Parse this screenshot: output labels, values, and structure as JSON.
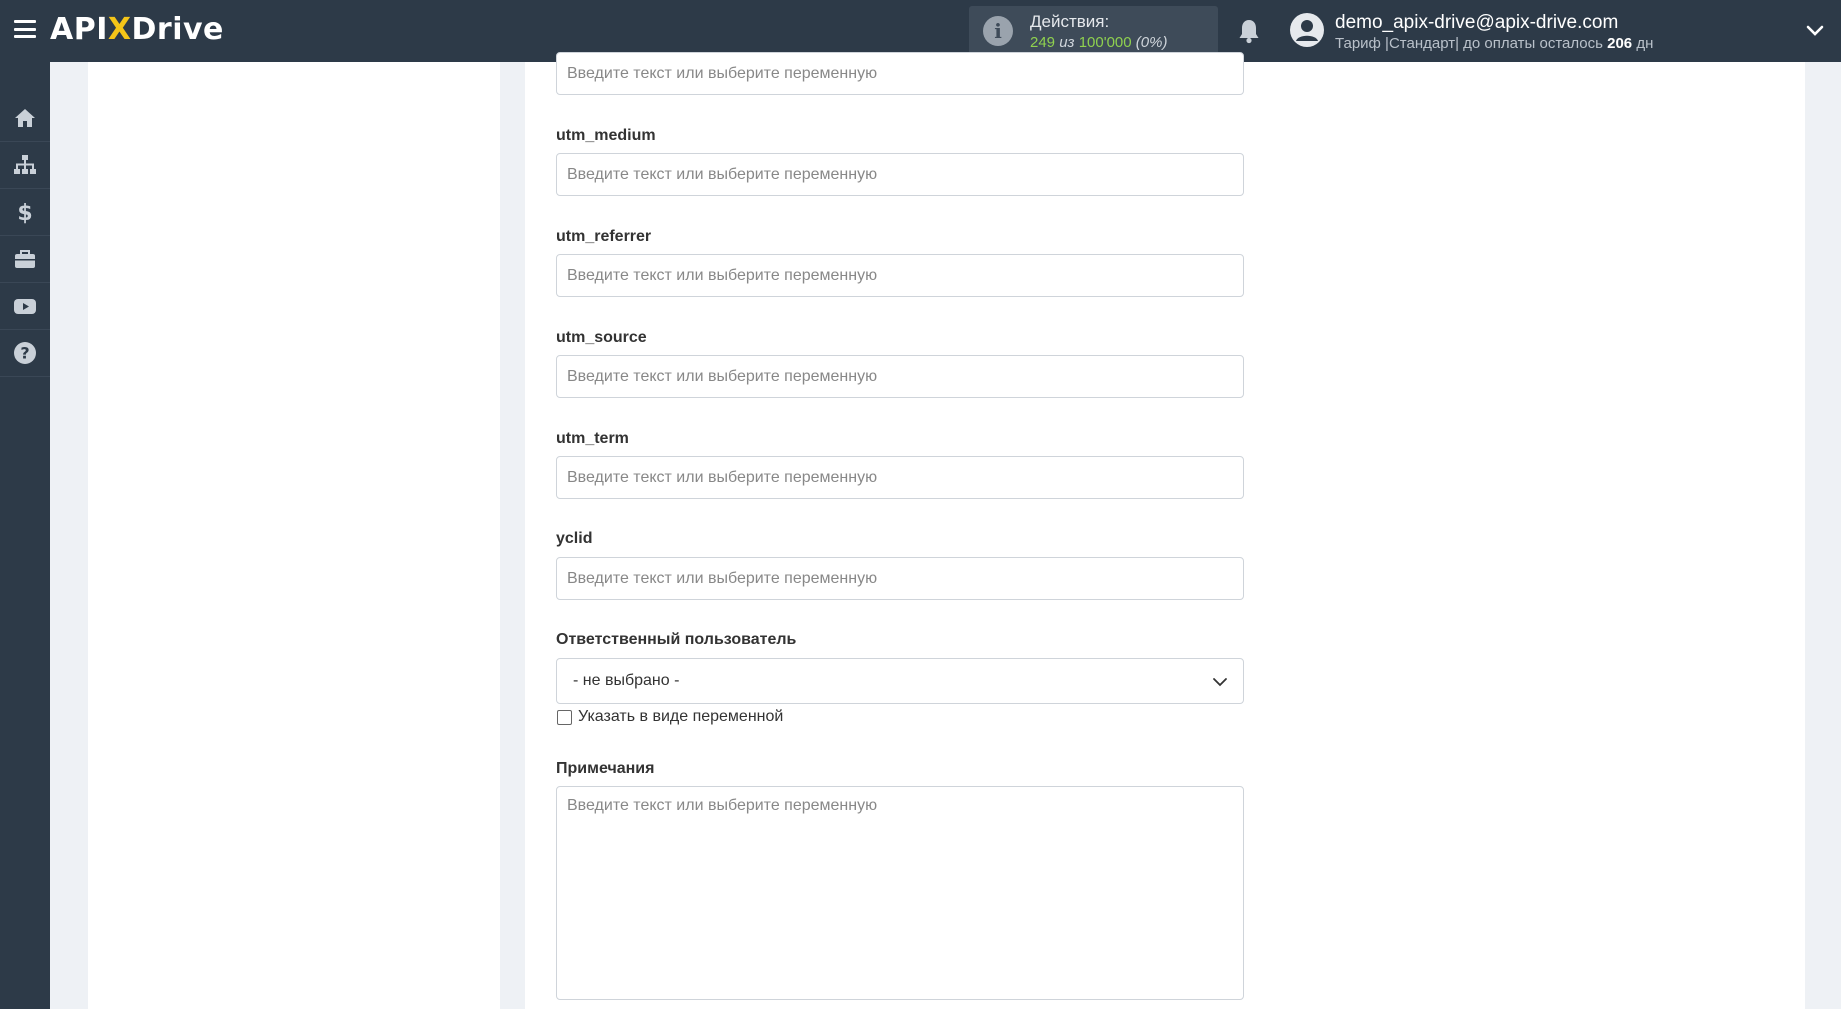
{
  "header": {
    "logo_api": "API",
    "logo_x": "X",
    "logo_drive": "Drive",
    "actions_title": "Действия:",
    "actions_used": "249",
    "actions_of": "из",
    "actions_total": "100'000",
    "actions_pct": "(0%)",
    "user_email": "demo_apix-drive@apix-drive.com",
    "plan_prefix": "Тариф |Стандарт| до оплаты осталось",
    "plan_days": "206",
    "plan_suffix": "дн"
  },
  "sidebar": {
    "items": [
      {
        "icon": "home-icon"
      },
      {
        "icon": "sitemap-icon"
      },
      {
        "icon": "dollar-icon"
      },
      {
        "icon": "briefcase-icon"
      },
      {
        "icon": "youtube-icon"
      },
      {
        "icon": "help-icon"
      }
    ]
  },
  "form": {
    "placeholder": "Введите текст или выберите переменную",
    "fields": [
      {
        "label": ""
      },
      {
        "label": "utm_medium"
      },
      {
        "label": "utm_referrer"
      },
      {
        "label": "utm_source"
      },
      {
        "label": "utm_term"
      },
      {
        "label": "yclid"
      }
    ],
    "responsible_label": "Ответственный пользователь",
    "responsible_value": "- не выбрано -",
    "as_variable_label": "Указать в виде переменной",
    "notes_label": "Примечания"
  },
  "colors": {
    "topbar": "#2d3a48",
    "accent_green": "#8fd14f",
    "logo_x": "#f5c518"
  }
}
